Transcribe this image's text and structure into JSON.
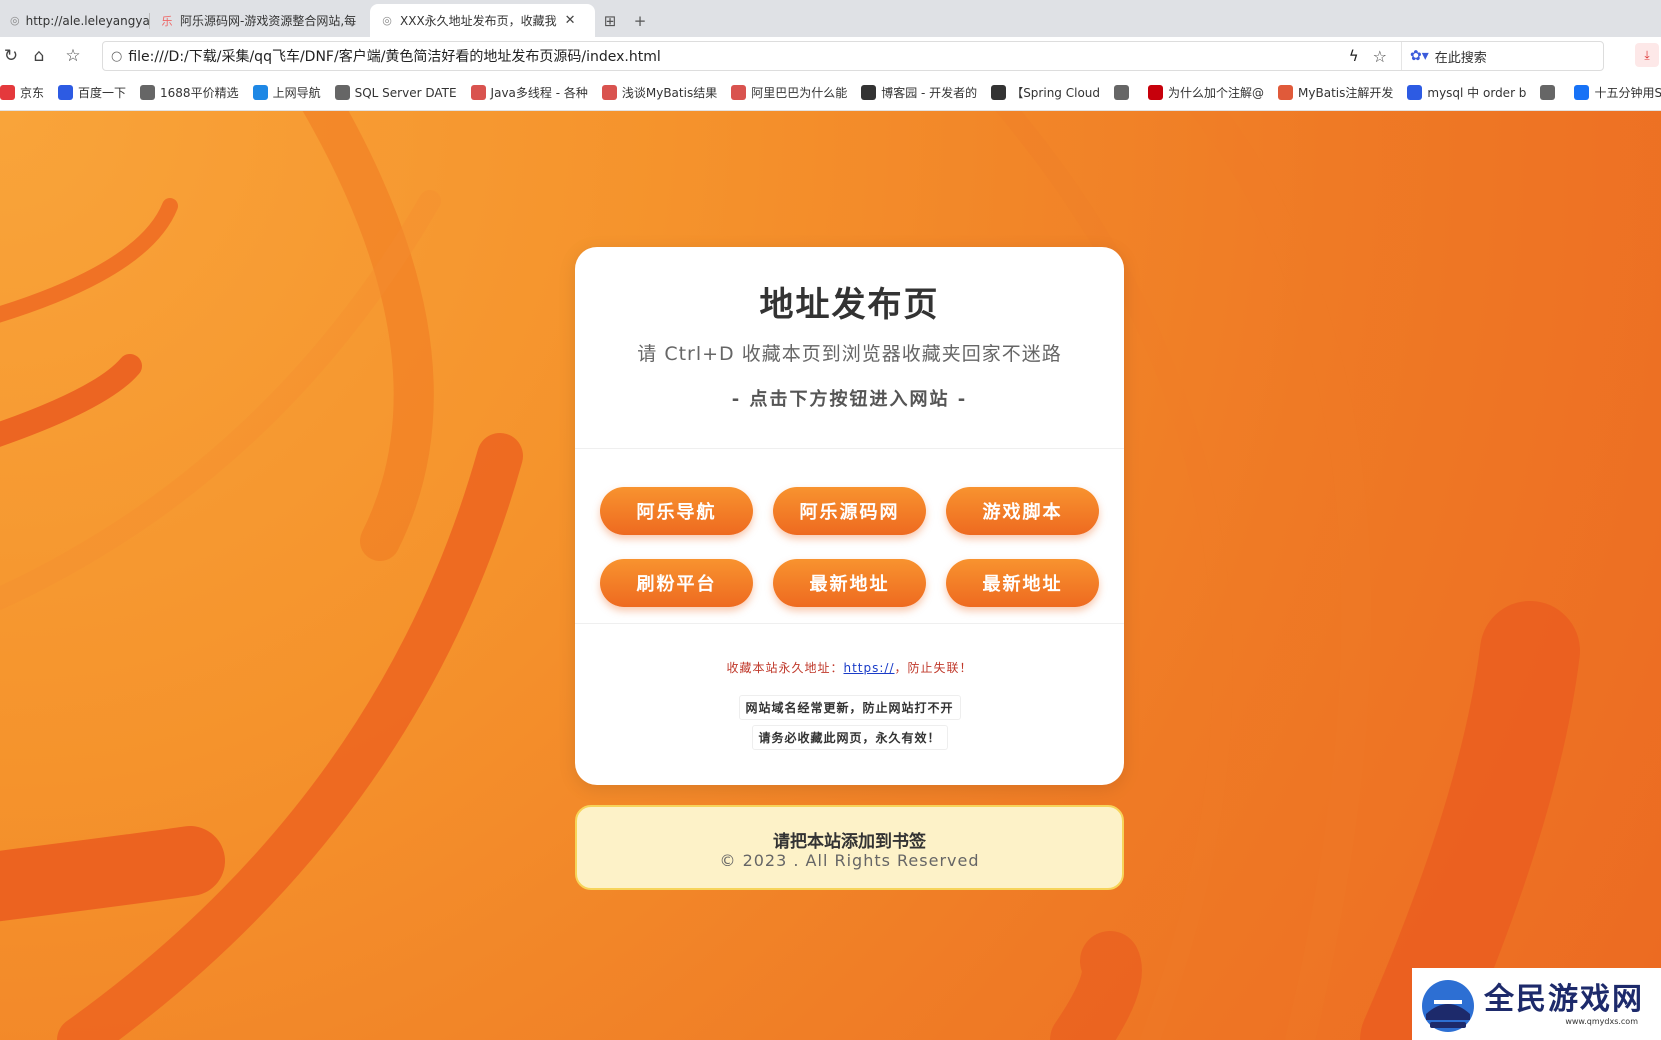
{
  "browser": {
    "tabs": [
      {
        "label": "http://ale.leleyangyan",
        "icon": "globe-icon"
      },
      {
        "label": "阿乐源码网-游戏资源整合网站,每",
        "icon": "site-icon"
      },
      {
        "label": "XXX永久地址发布页，收藏我",
        "icon": "globe-icon",
        "active": true
      }
    ],
    "address": "file:///D:/下载/采集/qq飞车/DNF/客户端/黄色简洁好看的地址发布页源码/index.html",
    "search_placeholder": "在此搜索",
    "bookmarks": [
      {
        "label": "京东",
        "color": "#e4393c"
      },
      {
        "label": "百度一下",
        "color": "#2d5be3"
      },
      {
        "label": "1688平价精选",
        "color": "#666666"
      },
      {
        "label": "上网导航",
        "color": "#1e88e5"
      },
      {
        "label": "SQL Server DATE",
        "color": "#666666"
      },
      {
        "label": "Java多线程 - 各种",
        "color": "#d9534f"
      },
      {
        "label": "浅谈MyBatis结果",
        "color": "#d9534f"
      },
      {
        "label": "阿里巴巴为什么能",
        "color": "#d9534f"
      },
      {
        "label": "博客园 - 开发者的",
        "color": "#333333"
      },
      {
        "label": "【Spring Cloud",
        "color": "#333333"
      },
      {
        "label": "",
        "color": "#666666"
      },
      {
        "label": "为什么加个注解@",
        "color": "#c7000b"
      },
      {
        "label": "MyBatis注解开发",
        "color": "#e05a3a"
      },
      {
        "label": "mysql 中 order b",
        "color": "#2d5be3"
      },
      {
        "label": "",
        "color": "#666666"
      },
      {
        "label": "十五分钟用Sprin",
        "color": "#1772f6"
      }
    ]
  },
  "card": {
    "title": "地址发布页",
    "subtitle": "请 Ctrl+D 收藏本页到浏览器收藏夹回家不迷路",
    "hint": "- 点击下方按钮进入网站 -",
    "buttons": [
      "阿乐导航",
      "阿乐源码网",
      "游戏脚本",
      "刷粉平台",
      "最新地址",
      "最新地址"
    ],
    "permanent_prefix": "收藏本站永久地址：",
    "permanent_link": "https://",
    "permanent_suffix": "，防止失联！",
    "note1": "网站域名经常更新，防止网站打不开",
    "note2": "请务必收藏此网页，永久有效！"
  },
  "footer": {
    "title": "请把本站添加到书签",
    "copyright": "© 2023 . All Rights Reserved"
  },
  "watermark": {
    "name": "全民游戏网",
    "url": "www.qmydxs.com"
  },
  "colors": {
    "accent": "#ee6a20",
    "background": "#f28a2b",
    "footer_bg": "#fdf2c8",
    "link": "#1a3cc8",
    "warning_text": "#c0392b"
  }
}
